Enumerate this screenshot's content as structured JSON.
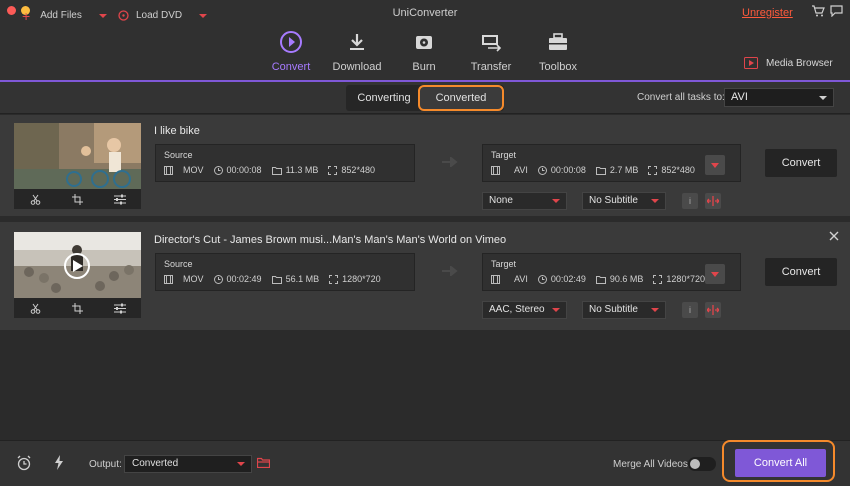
{
  "app": {
    "title": "UniConverter",
    "unregister_label": "Unregister",
    "accent": "#7f58d7",
    "highlight": "#f58a2b"
  },
  "nav": {
    "items": [
      {
        "label": "Convert",
        "icon": "convert-icon",
        "active": true
      },
      {
        "label": "Download",
        "icon": "download-icon"
      },
      {
        "label": "Burn",
        "icon": "burn-icon"
      },
      {
        "label": "Transfer",
        "icon": "transfer-icon"
      },
      {
        "label": "Toolbox",
        "icon": "toolbox-icon"
      }
    ],
    "media_browser": "Media Browser"
  },
  "subbar": {
    "add_files": "Add Files",
    "load_dvd": "Load DVD",
    "tabs": [
      "Converting",
      "Converted"
    ],
    "convert_all_tasks_label": "Convert all tasks to:",
    "format": "AVI"
  },
  "tasks": [
    {
      "title": "I like bike",
      "source": {
        "label": "Source",
        "format": "MOV",
        "duration": "00:00:08",
        "size": "11.3 MB",
        "resolution": "852*480"
      },
      "target": {
        "label": "Target",
        "format": "AVI",
        "duration": "00:00:08",
        "size": "2.7 MB",
        "resolution": "852*480"
      },
      "audio": "None",
      "subtitle": "No Subtitle",
      "convert_label": "Convert"
    },
    {
      "title": "Director's Cut - James Brown musi...Man's Man's Man's World on Vimeo",
      "source": {
        "label": "Source",
        "format": "MOV",
        "duration": "00:02:49",
        "size": "56.1 MB",
        "resolution": "1280*720"
      },
      "target": {
        "label": "Target",
        "format": "AVI",
        "duration": "00:02:49",
        "size": "90.6 MB",
        "resolution": "1280*720"
      },
      "audio": "AAC, Stereo",
      "subtitle": "No Subtitle",
      "convert_label": "Convert"
    }
  ],
  "bottom": {
    "output_label": "Output:",
    "output_value": "Converted",
    "merge_label": "Merge All Videos:",
    "convert_all_label": "Convert All"
  }
}
